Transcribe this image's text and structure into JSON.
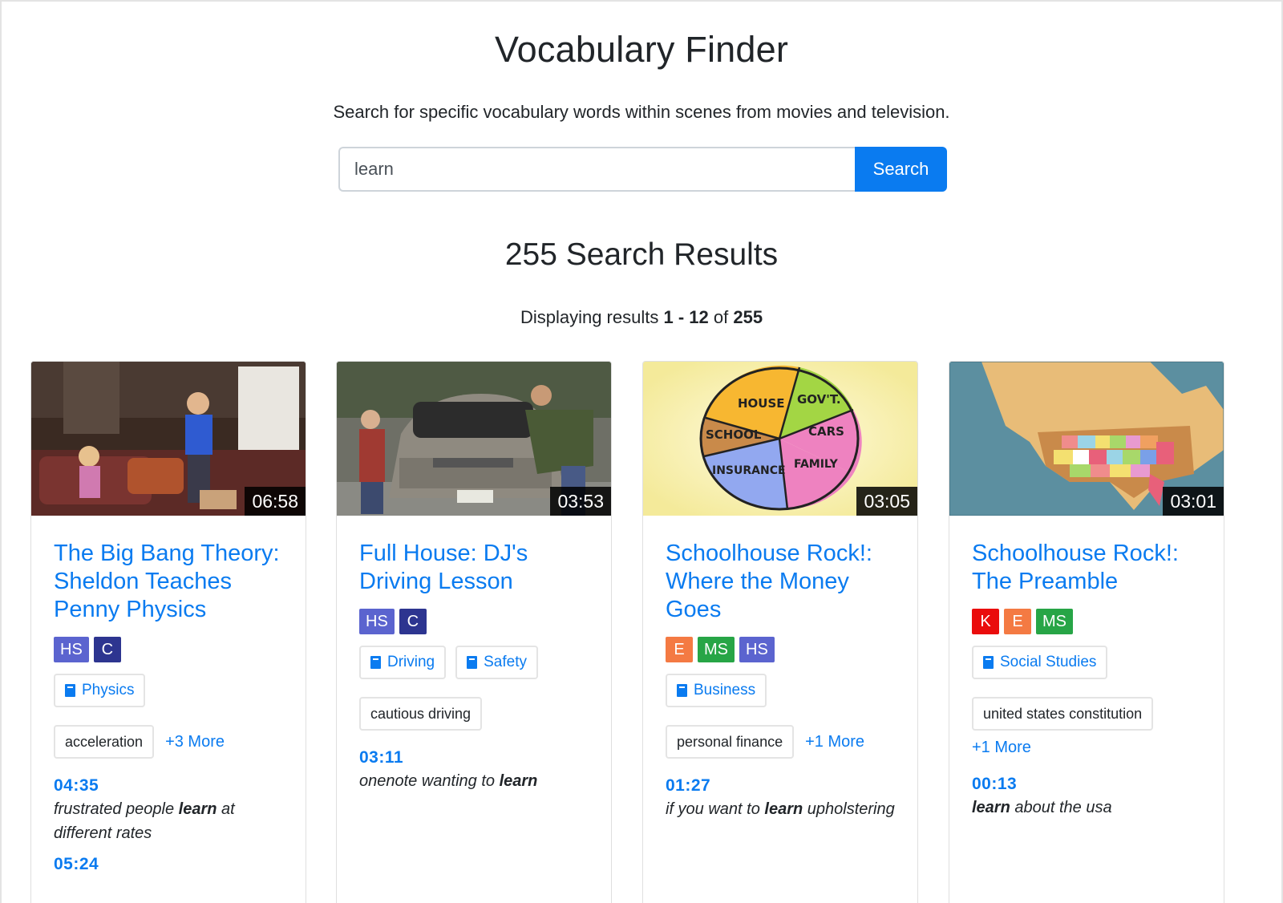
{
  "header": {
    "title": "Vocabulary Finder",
    "subtitle": "Search for specific vocabulary words within scenes from movies and television."
  },
  "search": {
    "value": "learn",
    "placeholder": "",
    "button_label": "Search"
  },
  "results": {
    "heading": "255 Search Results",
    "range_prefix": "Displaying results",
    "range_start_end": "1 - 12",
    "range_of": "of",
    "total": "255"
  },
  "level_colors": {
    "HS": "#5b64cf",
    "C": "#2d3590",
    "K": "#ea0c0c",
    "E": "#f47a43",
    "MS": "#27a546"
  },
  "accent_color": "#0a7bf0",
  "cards": [
    {
      "duration": "06:58",
      "title": "The Big Bang Theory: Sheldon Teaches Penny Physics",
      "levels": [
        "HS",
        "C"
      ],
      "subjects": [
        "Physics"
      ],
      "topics": [
        "acceleration"
      ],
      "more": "+3 More",
      "matches": [
        {
          "time": "04:35",
          "before": "frustrated people ",
          "keyword": "learn",
          "after": " at different rates"
        },
        {
          "time": "05:24",
          "before": "",
          "keyword": "",
          "after": ""
        }
      ]
    },
    {
      "duration": "03:53",
      "title": "Full House: DJ's Driving Lesson",
      "levels": [
        "HS",
        "C"
      ],
      "subjects": [
        "Driving",
        "Safety"
      ],
      "topics": [
        "cautious driving"
      ],
      "more": "",
      "matches": [
        {
          "time": "03:11",
          "before": "onenote wanting to ",
          "keyword": "learn",
          "after": ""
        }
      ]
    },
    {
      "duration": "03:05",
      "title": "Schoolhouse Rock!: Where the Money Goes",
      "levels": [
        "E",
        "MS",
        "HS"
      ],
      "subjects": [
        "Business"
      ],
      "topics": [
        "personal finance"
      ],
      "more": "+1 More",
      "matches": [
        {
          "time": "01:27",
          "before": "if you want to ",
          "keyword": "learn",
          "after": " upholstering"
        }
      ]
    },
    {
      "duration": "03:01",
      "title": "Schoolhouse Rock!: The Preamble",
      "levels": [
        "K",
        "E",
        "MS"
      ],
      "subjects": [
        "Social Studies"
      ],
      "topics": [
        "united states constitution"
      ],
      "more": "+1 More",
      "more_on_new_line": true,
      "matches": [
        {
          "time": "00:13",
          "before": "",
          "keyword": "learn",
          "after": " about the usa"
        }
      ]
    }
  ],
  "pie_labels": [
    "HOUSE",
    "GOV'T.",
    "SCHOOL",
    "CARS",
    "INSURANCE",
    "FAMILY"
  ]
}
